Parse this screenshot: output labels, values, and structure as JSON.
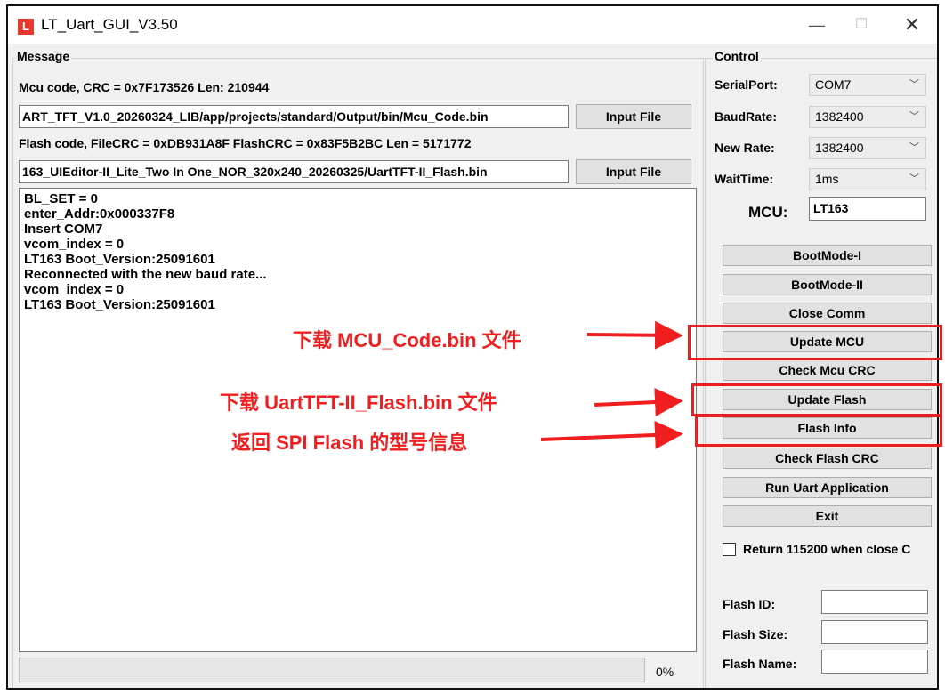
{
  "window": {
    "title": "LT_Uart_GUI_V3.50",
    "minimize": "—",
    "maximize": "☐",
    "close": "✕"
  },
  "message": {
    "group_title": "Message",
    "mcu_info": "Mcu code, CRC = 0x7F173526 Len: 210944",
    "mcu_path": "ART_TFT_V1.0_20260324_LIB/app/projects/standard/Output/bin/Mcu_Code.bin",
    "flash_info": "Flash code, FileCRC = 0xDB931A8F  FlashCRC = 0x83F5B2BC  Len = 5171772",
    "flash_path": "163_UIEditor-II_Lite_Two In One_NOR_320x240_20260325/UartTFT-II_Flash.bin",
    "input_file_1": "Input File",
    "input_file_2": "Input File",
    "log": [
      "BL_SET = 0",
      "enter_Addr:0x000337F8",
      "Insert COM7",
      "vcom_index = 0",
      "LT163 Boot_Version:25091601",
      "Reconnected with the new baud rate...",
      "vcom_index = 0",
      "LT163 Boot_Version:25091601"
    ],
    "progress_percent": 0,
    "progress_label": "0%"
  },
  "control": {
    "group_title": "Control",
    "serial_port_label": "SerialPort:",
    "serial_port_value": "COM7",
    "baud_rate_label": "BaudRate:",
    "baud_rate_value": "1382400",
    "new_rate_label": "New Rate:",
    "new_rate_value": "1382400",
    "wait_time_label": "WaitTime:",
    "wait_time_value": "1ms",
    "mcu_label": "MCU:",
    "mcu_value": "LT163",
    "buttons": {
      "bootmode1": "BootMode-I",
      "bootmode2": "BootMode-II",
      "close_comm": "Close Comm",
      "update_mcu": "Update MCU",
      "check_mcu_crc": "Check Mcu CRC",
      "update_flash": "Update Flash",
      "flash_info": "Flash Info",
      "check_flash_crc": "Check Flash CRC",
      "run_uart_app": "Run Uart Application",
      "exit": "Exit"
    },
    "return_checkbox_label": "Return 115200 when close C",
    "return_checkbox_checked": false,
    "flash_id_label": "Flash ID:",
    "flash_size_label": "Flash Size:",
    "flash_name_label": "Flash Name:",
    "flash_id_value": "",
    "flash_size_value": "",
    "flash_name_value": ""
  },
  "annotations": {
    "note_mcu": "下载 MCU_Code.bin 文件",
    "note_flash": "下载 UartTFT-II_Flash.bin 文件",
    "note_info": "返回 SPI Flash 的型号信息",
    "color": "#f01e1e"
  }
}
